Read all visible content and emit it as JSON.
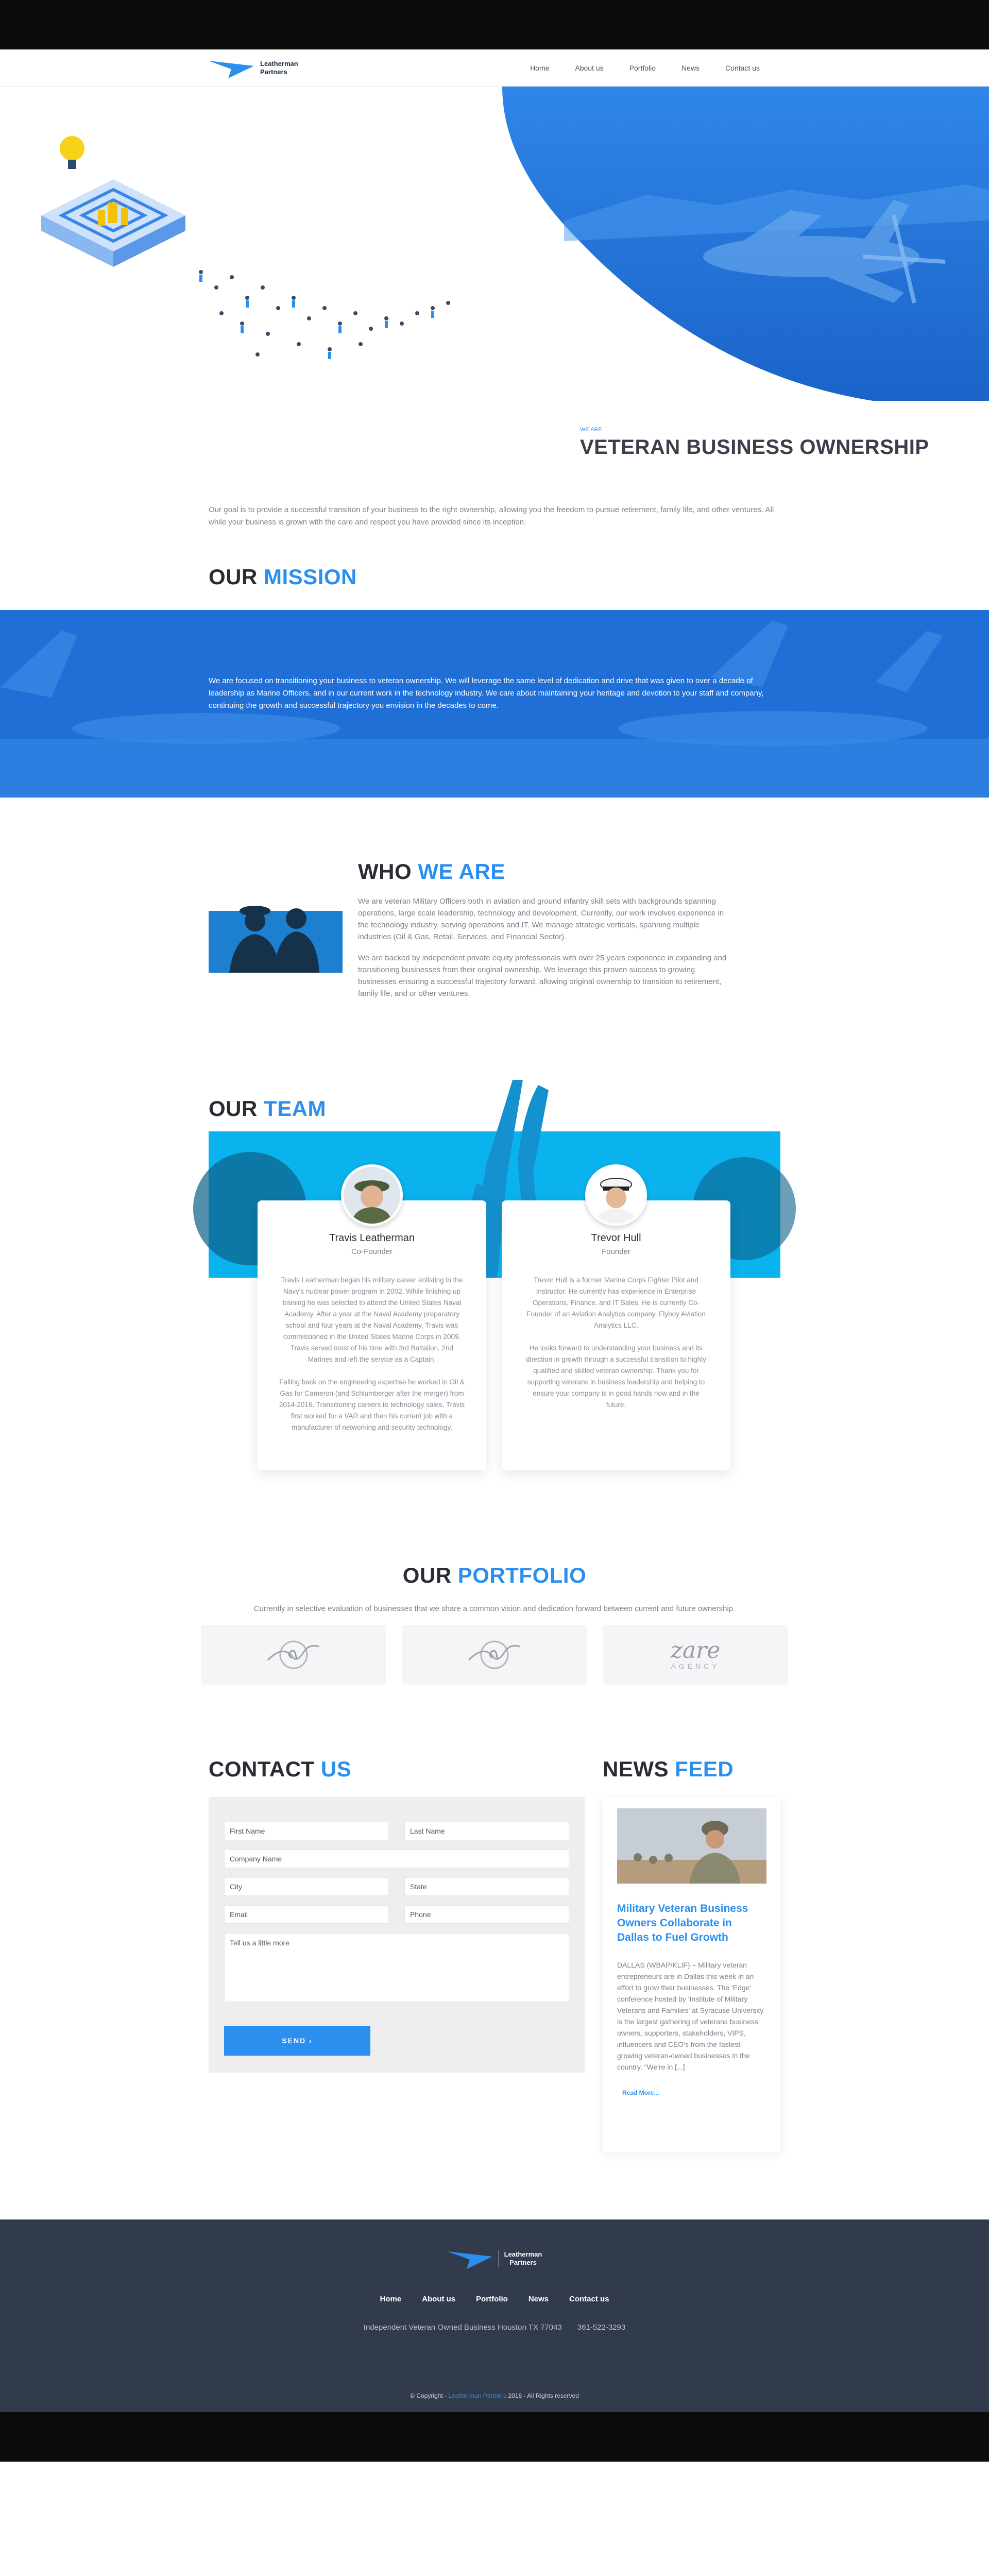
{
  "brand": {
    "name_line1": "Leatherman",
    "name_line2": "Partners"
  },
  "nav": [
    "Home",
    "About us",
    "Portfolio",
    "News",
    "Contact us"
  ],
  "hero": {
    "kicker": "WE ARE",
    "title": "VETERAN BUSINESS OWNERSHIP"
  },
  "intro": "Our goal is to provide a successful transition of your business to the right ownership, allowing you the freedom to pursue retirement, family life, and other ventures. All while your business is grown with the care and respect you have provided since its inception.",
  "mission": {
    "title_a": "OUR",
    "title_b": "MISSION",
    "body": "We are focused on transitioning your business to veteran ownership. We will leverage the same level of dedication and drive that was given to over a decade of leadership as Marine Officers, and in our current work in the technology industry. We care about maintaining your heritage and devotion to your staff and company, continuing the growth and successful trajectory you envision in the decades to come."
  },
  "who": {
    "title_a": "WHO",
    "title_b": "WE ARE",
    "p1": "We are veteran Military Officers both in aviation and ground infantry skill sets with backgrounds spanning operations, large scale leadership, technology and development. Currently, our work involves experience in the technology industry, serving operations and IT. We manage strategic verticals, spanning multiple industries (Oil & Gas, Retail, Services, and Financial Sector).",
    "p2": "We are backed by independent private equity professionals with over 25 years experience in expanding and transitioning businesses from their original ownership. We leverage this proven success to growing businesses ensuring a successful trajectory forward, allowing original ownership to transition to retirement, family life, and or other ventures."
  },
  "team": {
    "title_a": "OUR",
    "title_b": "TEAM",
    "members": [
      {
        "name": "Travis Leatherman",
        "role": "Co-Founder",
        "p1": "Travis Leatherman began his military career enlisting in the Navy's nuclear power program in 2002. While finishing up training he was selected to attend the United States Naval Academy. After a year at the Naval Academy preparatory school and four years at the Naval Academy, Travis was commissioned in the United States Marine Corps in 2009. Travis served most of his time with 3rd Battalion, 2nd Marines and left the service as a Captain.",
        "p2": "Falling back on the engineering expertise he worked in Oil & Gas for Cameron (and Schlumberger after the merger) from 2014-2016. Transitioning careers to technology sales, Travis first worked for a VAR and then his current job with a manufacturer of networking and security technology."
      },
      {
        "name": "Trevor Hull",
        "role": "Founder",
        "p1": "Trevor Hull is a former Marine Corps Fighter Pilot and Instructor. He currently has experience in Enterprise Operations, Finance, and IT Sales. He is currently Co-Founder of an Aviation Analytics company, Flyboy Aviation Analytics LLC.",
        "p2": "He looks forward to understanding your business and its direction in growth through a successful transition to highly qualified and skilled veteran ownership. Thank you for supporting veterans in business leadership and helping to ensure your company is in good hands now and in the future."
      }
    ]
  },
  "portfolio": {
    "title_a": "OUR",
    "title_b": "PORTFOLIO",
    "subtitle": "Currently in selective evaluation of businesses that we share a common vision and dedication forward between current and future ownership.",
    "logo3_main": "zare",
    "logo3_sub": "AGENCY"
  },
  "contact": {
    "title_a": "CONTACT",
    "title_b": "US",
    "first_name": "First Name",
    "last_name": "Last Name",
    "company": "Company Name",
    "city": "City",
    "state": "State",
    "email": "Email",
    "phone": "Phone",
    "message": "Tell us a little more",
    "send": "SEND ›"
  },
  "news": {
    "title_a": "NEWS",
    "title_b": "FEED",
    "headline": "Military Veteran Business Owners Collaborate in Dallas to Fuel Growth",
    "body": "DALLAS (WBAP/KLIF) – Military veteran entrepreneurs are in Dallas this week in an effort to grow their businesses. The 'Edge' conference hosted by 'Institute of Military Veterans and Families' at Syracuse University is the largest gathering of veterans business owners, supporters, stakeholders, VIPS, influencers and CEO's from the fastest-growing veteran-owned businesses in the country. \"We're in [...]",
    "read_more": "Read More..."
  },
  "footer": {
    "nav": [
      "Home",
      "About us",
      "Portfolio",
      "News",
      "Contact us"
    ],
    "address": "Independent Veteran Owned Business Houston TX 77043",
    "phone": "361-522-3293",
    "copy_a": "© Copyright - ",
    "copy_b": "Leatherman Partners",
    "copy_c": " 2016 - All Rights reserved"
  }
}
